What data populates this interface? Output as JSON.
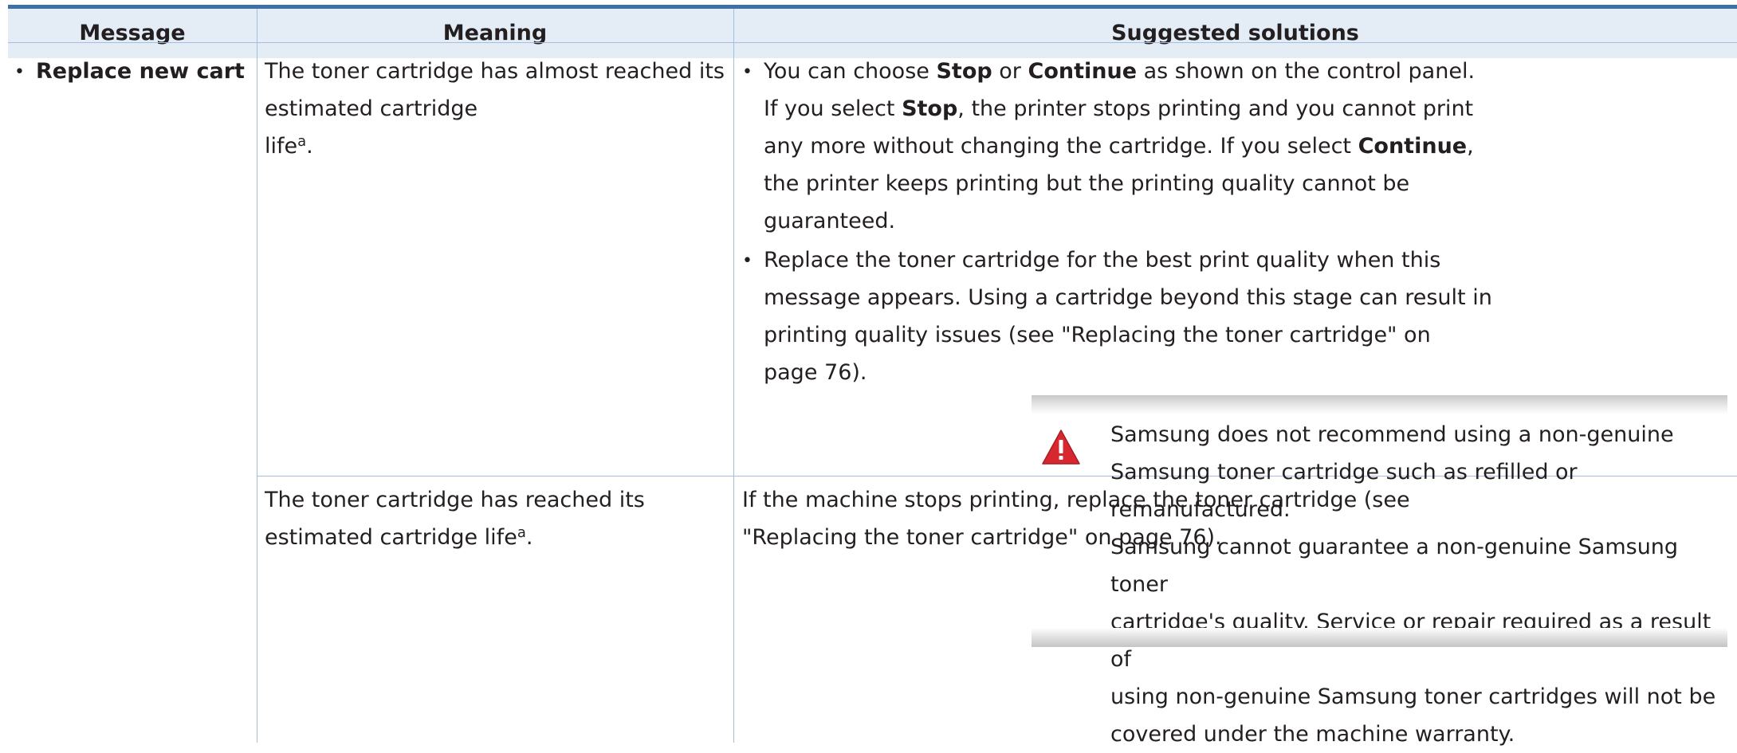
{
  "table": {
    "headers": [
      "Message",
      "Meaning",
      "Suggested solutions"
    ],
    "row1": {
      "message": "Replace new cart",
      "meaning_1": "The toner cartridge has almost reached its estimated cartridge",
      "meaning_2": "life",
      "meaning_sup": "a",
      "meaning_end": ".",
      "sol1": {
        "l1_a": "You can choose ",
        "l1_b": "Stop",
        "l1_c": " or ",
        "l1_d": "Continue",
        "l1_e": " as shown on the control panel.",
        "l2_a": "If you select ",
        "l2_b": "Stop",
        "l2_c": ", the printer stops printing and you cannot print",
        "l3_a": "any more without changing the cartridge. If you select ",
        "l3_b": "Continue",
        "l3_c": ",",
        "l4": "the printer keeps printing but the printing quality cannot be",
        "l5": "guaranteed."
      },
      "sol2": {
        "l1": "Replace the toner cartridge for the best print quality when this",
        "l2": "message appears. Using a cartridge beyond this stage can result in",
        "l3": "printing quality issues (see \"Replacing the toner cartridge\" on",
        "l4": "page 76)."
      },
      "warning": {
        "icon": "warning-triangle-icon",
        "lines": [
          "Samsung does not recommend using a non-genuine",
          "Samsung toner cartridge such as refilled or remanufactured.",
          "Samsung cannot guarantee a non-genuine Samsung toner",
          "cartridge's quality. Service or repair required as a result of",
          "using non-genuine Samsung toner cartridges will not be",
          "covered under the machine warranty."
        ]
      }
    },
    "row2": {
      "meaning": "The toner cartridge has reached its estimated cartridge life",
      "meaning_sup": "a",
      "meaning_end": ".",
      "sol_l1": "If the machine stops printing, replace the toner cartridge (see",
      "sol_l2": "\"Replacing the toner cartridge\" on page 76)."
    }
  },
  "colors": {
    "header_bg": "#e4ecf6",
    "top_rule": "#3d6fa8",
    "grid": "#a4bfdd",
    "warning_red": "#d7282f"
  }
}
